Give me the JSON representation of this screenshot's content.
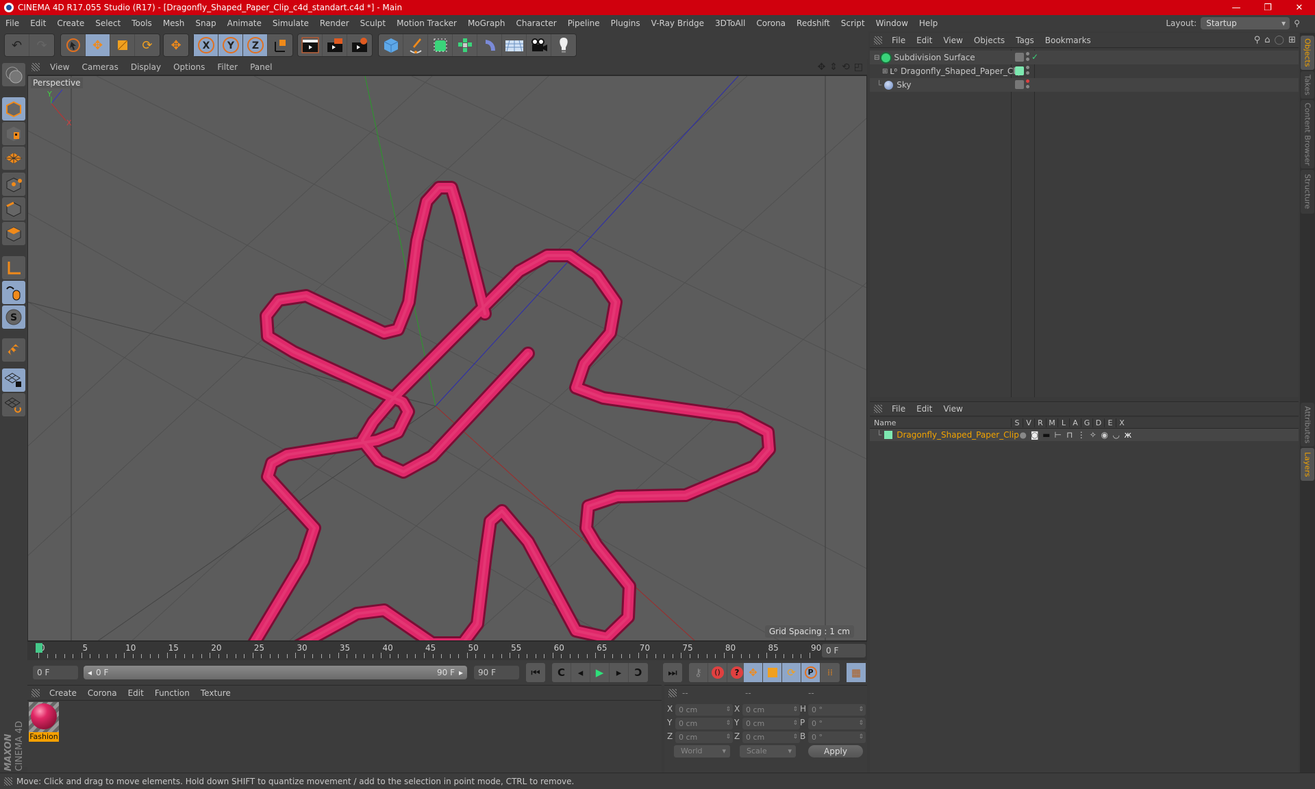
{
  "window": {
    "title": "CINEMA 4D R17.055 Studio (R17) - [Dragonfly_Shaped_Paper_Clip_c4d_standart.c4d *] - Main",
    "controls": {
      "minimize": "—",
      "maximize": "❐",
      "close": "✕"
    }
  },
  "menubar": {
    "items": [
      "File",
      "Edit",
      "Create",
      "Select",
      "Tools",
      "Mesh",
      "Snap",
      "Animate",
      "Simulate",
      "Render",
      "Sculpt",
      "Motion Tracker",
      "MoGraph",
      "Character",
      "Pipeline",
      "Plugins",
      "V-Ray Bridge",
      "3DToAll",
      "Corona",
      "Redshift",
      "Script",
      "Window",
      "Help"
    ],
    "layout_label": "Layout:",
    "layout_value": "Startup"
  },
  "toolbar": {
    "groups": [
      {
        "icons": [
          "undo-icon",
          "redo-icon"
        ]
      },
      {
        "icons": [
          "live-selection-icon",
          "move-icon",
          "scale-icon",
          "rotate-icon"
        ]
      },
      {
        "icons": [
          "recent-tool-icon"
        ]
      },
      {
        "icons": [
          "x-axis-lock-icon",
          "y-axis-lock-icon",
          "z-axis-lock-icon",
          "coordinate-system-icon"
        ]
      },
      {
        "icons": [
          "render-view-icon",
          "render-picture-viewer-icon",
          "render-settings-icon"
        ]
      },
      {
        "icons": [
          "cube-primitive-icon",
          "spline-pen-icon",
          "subdivision-surface-icon",
          "cloner-icon",
          "deformer-icon",
          "floor-icon",
          "camera-icon",
          "light-icon"
        ]
      }
    ],
    "axis_labels": [
      "X",
      "Y",
      "Z"
    ]
  },
  "left_toolbar": {
    "icons": [
      "make-editable-icon",
      "model-mode-icon",
      "texture-mode-icon",
      "workplane-mode-icon",
      "points-mode-icon",
      "edges-mode-icon",
      "polygons-mode-icon",
      "axis-mode-icon",
      "tweak-mode-icon",
      "solo-mode-icon",
      "snapping-icon",
      "locked-workplane-icon",
      "workplane-rotate-icon"
    ]
  },
  "viewport": {
    "menu": [
      "View",
      "Cameras",
      "Display",
      "Options",
      "Filter",
      "Panel"
    ],
    "camera_label": "Perspective",
    "grid_spacing": "Grid Spacing : 1 cm",
    "nav_icons": [
      "pan-icon",
      "dolly-icon",
      "orbit-icon",
      "maximize-viewport-icon"
    ],
    "axis_gizmo": {
      "x": "X",
      "y": "Y",
      "z": "Z"
    },
    "object_color": "#e0286a"
  },
  "timeline": {
    "ticks": [
      0,
      5,
      10,
      15,
      20,
      25,
      30,
      35,
      40,
      45,
      50,
      55,
      60,
      65,
      70,
      75,
      80,
      85,
      90
    ],
    "current_frame_display": "0 F",
    "start_field": "0 F",
    "range_start": "0 F",
    "range_end": "90 F",
    "end_field": "90 F"
  },
  "transport": {
    "buttons": [
      "go-to-start-icon",
      "previous-key-icon",
      "previous-frame-icon",
      "play-icon",
      "next-frame-icon",
      "next-key-icon",
      "go-to-end-icon"
    ],
    "key_buttons": [
      "keyframe-selection-icon",
      "autokey-icon",
      "help-icon"
    ],
    "key_tracks": [
      "move-track-icon",
      "scale-track-icon",
      "rotate-track-icon",
      "param-track-icon",
      "pla-track-icon"
    ],
    "timeline_icon": "timeline-window-icon"
  },
  "material_manager": {
    "menu": [
      "Create",
      "Corona",
      "Edit",
      "Function",
      "Texture"
    ],
    "materials": [
      {
        "name": "Fashion",
        "color": "#e02865"
      }
    ]
  },
  "coordinates": {
    "headers": [
      "--",
      "--",
      "--"
    ],
    "rows": [
      {
        "pos_label": "X",
        "pos": "0 cm",
        "size_label": "X",
        "size": "0 cm",
        "rot_label": "H",
        "rot": "0 °"
      },
      {
        "pos_label": "Y",
        "pos": "0 cm",
        "size_label": "Y",
        "size": "0 cm",
        "rot_label": "P",
        "rot": "0 °"
      },
      {
        "pos_label": "Z",
        "pos": "0 cm",
        "size_label": "Z",
        "size": "0 cm",
        "rot_label": "B",
        "rot": "0 °"
      }
    ],
    "mode": "World",
    "scale_mode": "Scale",
    "apply": "Apply"
  },
  "object_manager": {
    "menu": [
      "File",
      "Edit",
      "View",
      "Objects",
      "Tags",
      "Bookmarks"
    ],
    "objects": [
      {
        "name": "Subdivision Surface",
        "icon": "subdivision-surface-icon",
        "icon_color": "#3ad47a",
        "expanded": true
      },
      {
        "name": "Dragonfly_Shaped_Paper_Clip",
        "icon": "null-object-icon",
        "layer_color": "#7de8b0",
        "expanded": false
      },
      {
        "name": "Sky",
        "icon": "sky-icon",
        "icon_color": "#8aa8d8"
      }
    ]
  },
  "layer_manager": {
    "menu": [
      "File",
      "Edit",
      "View"
    ],
    "columns": [
      "Name",
      "S",
      "V",
      "R",
      "M",
      "L",
      "A",
      "G",
      "D",
      "E",
      "X"
    ],
    "layers": [
      {
        "name": "Dragonfly_Shaped_Paper_Clip",
        "color": "#7de8b0",
        "text_color": "#f2a300"
      }
    ]
  },
  "side_tabs": {
    "top": [
      "Objects",
      "Takes",
      "Content Browser",
      "Structure"
    ],
    "bottom": [
      "Attributes",
      "Layers"
    ]
  },
  "branding": {
    "maxon": "MAXON",
    "product": "CINEMA 4D"
  },
  "status": {
    "message": "Move: Click and drag to move elements. Hold down SHIFT to quantize movement / add to the selection in point mode, CTRL to remove."
  }
}
